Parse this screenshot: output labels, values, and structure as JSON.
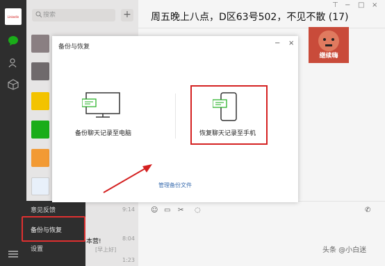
{
  "sidebar": {
    "logo_text": "Linkedin",
    "search_placeholder": "搜索",
    "add_label": "+"
  },
  "chat": {
    "title": "周五晚上八点，D区63号502，不见不散 (17)",
    "sticker_caption": "继续嗨",
    "window_controls": {
      "pin": "⊤",
      "min": "−",
      "max": "□",
      "close": "×"
    }
  },
  "dialog": {
    "title": "备份与恢复",
    "minimize": "−",
    "close": "×",
    "backup_label": "备份聊天记录至电脑",
    "restore_label": "恢复聊天记录至手机",
    "manage_link": "管理备份文件"
  },
  "menu": {
    "items": [
      "意见反馈",
      "备份与恢复",
      "设置"
    ]
  },
  "list_meta": {
    "time1": "9:14",
    "time2": "8:04",
    "time3": "1:23",
    "preview_text": "本营!",
    "preview_sub": "[早上好]"
  },
  "watermark": "头条 @小白迷"
}
